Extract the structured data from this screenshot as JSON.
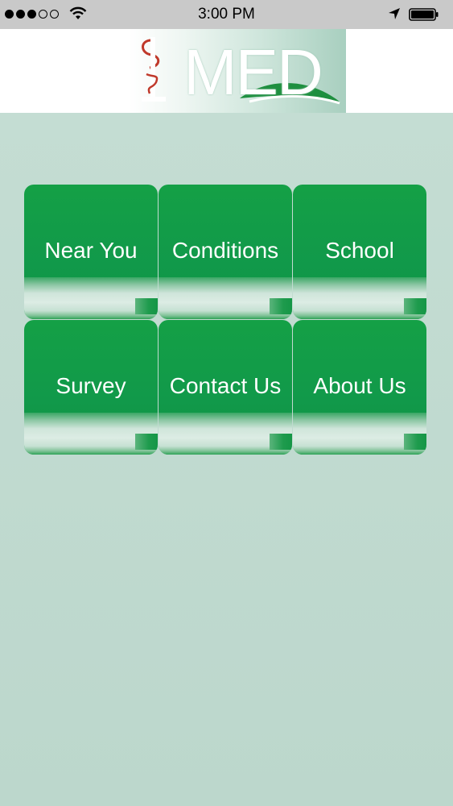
{
  "status_bar": {
    "time": "3:00 PM",
    "signal_bars_filled": 3,
    "signal_bars_total": 5,
    "icons": [
      "signal-dots-icon",
      "wifi-icon",
      "location-arrow-icon",
      "battery-icon"
    ]
  },
  "header": {
    "logo_text": "MED"
  },
  "colors": {
    "tile_green": "#14a046",
    "background": "#c3dcd2",
    "logo_red": "#c0392b"
  },
  "menu": {
    "items": [
      {
        "label": "Near You"
      },
      {
        "label": "Conditions"
      },
      {
        "label": "School"
      },
      {
        "label": "Survey"
      },
      {
        "label": "Contact Us"
      },
      {
        "label": "About Us"
      }
    ]
  }
}
